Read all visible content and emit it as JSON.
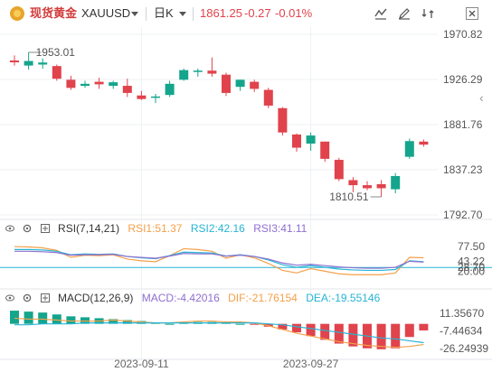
{
  "header": {
    "name": "现货黄金",
    "symbol": "XAUUSD",
    "period": "日K",
    "price": "1861.25",
    "change": "-0.27",
    "change_pct": "-0.01%"
  },
  "colors": {
    "up": "#14a58c",
    "down": "#e0434c",
    "rsi1": "#f4a04a",
    "rsi2": "#27b4d4",
    "rsi3": "#8e6fcf",
    "macd": "#8e6fcf",
    "dif": "#f4a04a",
    "dea": "#27b4d4"
  },
  "icons": [
    "coin-icon",
    "chevron-down-icon",
    "indicator-icon",
    "draw-icon",
    "compare-icon",
    "close-icon",
    "eye-icon",
    "settings-icon",
    "add-icon"
  ],
  "chart_data": [
    {
      "type": "candlestick",
      "ylim": [
        1792.7,
        1970.82
      ],
      "y_ticks": [
        "1970.82",
        "1926.29",
        "1881.76",
        "1837.23",
        "1792.70"
      ],
      "x_ticks": [
        "2023-09-11",
        "2023-09-27"
      ],
      "annotations": {
        "high": "1953.01",
        "low": "1810.51"
      },
      "candles": [
        {
          "o": 1945.0,
          "h": 1950.0,
          "l": 1940.0,
          "c": 1943.2
        },
        {
          "o": 1940.0,
          "h": 1953.01,
          "l": 1936.0,
          "c": 1944.5
        },
        {
          "o": 1941.0,
          "h": 1947.0,
          "l": 1937.0,
          "c": 1943.0
        },
        {
          "o": 1939.5,
          "h": 1941.0,
          "l": 1925.0,
          "c": 1927.0
        },
        {
          "o": 1926.0,
          "h": 1930.0,
          "l": 1916.0,
          "c": 1918.0
        },
        {
          "o": 1920.0,
          "h": 1925.0,
          "l": 1918.0,
          "c": 1922.0
        },
        {
          "o": 1924.0,
          "h": 1928.0,
          "l": 1917.0,
          "c": 1921.5
        },
        {
          "o": 1920.0,
          "h": 1925.0,
          "l": 1917.0,
          "c": 1923.5
        },
        {
          "o": 1920.0,
          "h": 1927.0,
          "l": 1909.0,
          "c": 1913.0
        },
        {
          "o": 1910.5,
          "h": 1915.0,
          "l": 1906.0,
          "c": 1907.0
        },
        {
          "o": 1909.0,
          "h": 1912.0,
          "l": 1903.0,
          "c": 1909.5
        },
        {
          "o": 1911.0,
          "h": 1925.0,
          "l": 1909.0,
          "c": 1922.0
        },
        {
          "o": 1926.0,
          "h": 1937.0,
          "l": 1925.0,
          "c": 1935.5
        },
        {
          "o": 1934.0,
          "h": 1937.0,
          "l": 1929.0,
          "c": 1935.0
        },
        {
          "o": 1935.0,
          "h": 1948.0,
          "l": 1929.0,
          "c": 1932.0
        },
        {
          "o": 1931.0,
          "h": 1933.0,
          "l": 1910.0,
          "c": 1913.0
        },
        {
          "o": 1919.0,
          "h": 1926.0,
          "l": 1915.0,
          "c": 1926.0
        },
        {
          "o": 1924.0,
          "h": 1926.0,
          "l": 1914.0,
          "c": 1917.0
        },
        {
          "o": 1916.0,
          "h": 1918.0,
          "l": 1898.0,
          "c": 1900.5
        },
        {
          "o": 1898.0,
          "h": 1899.0,
          "l": 1871.0,
          "c": 1874.0
        },
        {
          "o": 1872.0,
          "h": 1873.0,
          "l": 1855.0,
          "c": 1859.0
        },
        {
          "o": 1863.0,
          "h": 1874.0,
          "l": 1856.0,
          "c": 1871.0
        },
        {
          "o": 1865.0,
          "h": 1865.0,
          "l": 1845.0,
          "c": 1848.0
        },
        {
          "o": 1847.0,
          "h": 1849.0,
          "l": 1826.0,
          "c": 1828.0
        },
        {
          "o": 1827.0,
          "h": 1830.0,
          "l": 1815.0,
          "c": 1822.0
        },
        {
          "o": 1822.0,
          "h": 1826.0,
          "l": 1817.0,
          "c": 1819.0
        },
        {
          "o": 1823.0,
          "h": 1827.0,
          "l": 1810.51,
          "c": 1819.0
        },
        {
          "o": 1818.0,
          "h": 1834.0,
          "l": 1814.0,
          "c": 1831.0
        },
        {
          "o": 1850.0,
          "h": 1868.0,
          "l": 1848.0,
          "c": 1865.5
        },
        {
          "o": 1865.0,
          "h": 1867.0,
          "l": 1860.0,
          "c": 1862.0
        }
      ]
    },
    {
      "type": "line",
      "name": "RSI(7,14,21)",
      "values_text": {
        "rsi1": "RSI1:51.37",
        "rsi2": "RSI2:42.16",
        "rsi3": "RSI3:41.11"
      },
      "ylim": [
        0,
        100
      ],
      "y_ticks": [
        "77.50",
        "43.22",
        "28.70",
        "20.00"
      ],
      "series": [
        {
          "name": "RSI1",
          "values": [
            77,
            76,
            74,
            68,
            52,
            57,
            56,
            58,
            48,
            44,
            42,
            56,
            72,
            70,
            66,
            50,
            58,
            51,
            38,
            22,
            16,
            26,
            20,
            14,
            12,
            12,
            12,
            16,
            52,
            51
          ]
        },
        {
          "name": "RSI2",
          "values": [
            70,
            70,
            69,
            66,
            58,
            60,
            59,
            60,
            54,
            51,
            49,
            56,
            64,
            63,
            62,
            55,
            58,
            54,
            46,
            35,
            29,
            33,
            29,
            25,
            23,
            22,
            22,
            24,
            44,
            42
          ]
        },
        {
          "name": "RSI3",
          "values": [
            66,
            66,
            65,
            63,
            57,
            58,
            58,
            59,
            54,
            52,
            50,
            55,
            61,
            60,
            60,
            55,
            57,
            54,
            48,
            39,
            34,
            36,
            33,
            30,
            28,
            27,
            27,
            29,
            43,
            41
          ]
        }
      ]
    },
    {
      "type": "bar",
      "name": "MACD(12,26,9)",
      "values_text": {
        "macd": "MACD:-4.42016",
        "dif": "DIF:-21.76154",
        "dea": "DEA:-19.55146"
      },
      "ylim": [
        -32,
        16
      ],
      "y_ticks": [
        "11.35670",
        "-7.44634",
        "-26.24939"
      ],
      "macd": [
        14,
        13,
        12,
        10,
        8,
        7,
        6,
        5,
        4,
        3,
        1,
        0,
        1,
        2,
        2,
        1,
        0,
        -1,
        -3,
        -6,
        -9,
        -13,
        -17,
        -21,
        -24,
        -26,
        -27,
        -26,
        -14,
        -7
      ],
      "series": [
        {
          "name": "DIF",
          "values": [
            6,
            5,
            5,
            4,
            3,
            3,
            3,
            4,
            3,
            2,
            1,
            1,
            2,
            3,
            3,
            2,
            2,
            1,
            -2,
            -6,
            -10,
            -13,
            -16,
            -19,
            -21,
            -23,
            -24,
            -25,
            -24,
            -22
          ]
        },
        {
          "name": "DEA",
          "values": [
            -1,
            -1,
            0,
            0,
            0,
            1,
            1,
            1,
            1,
            1,
            1,
            1,
            1,
            1,
            1,
            1,
            1,
            1,
            0,
            -1,
            -3,
            -5,
            -7,
            -9,
            -11,
            -13,
            -15,
            -16,
            -18,
            -20
          ]
        }
      ]
    }
  ],
  "rsi_labels": {
    "title": "RSI(7,14,21)"
  },
  "macd_labels": {
    "title": "MACD(12,26,9)"
  }
}
